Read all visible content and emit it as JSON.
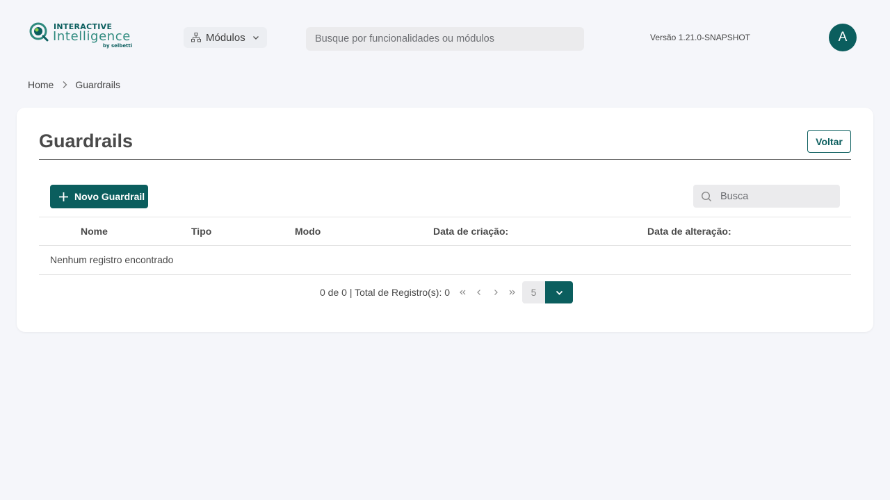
{
  "header": {
    "logo": {
      "line1": "INTERACTIVE",
      "line2": "Intelligence",
      "line3": "by selbetti"
    },
    "modules_label": "Módulos",
    "search_placeholder": "Busque por funcionalidades ou módulos",
    "version": "Versão 1.21.0-SNAPSHOT",
    "avatar_initial": "A"
  },
  "breadcrumb": {
    "home": "Home",
    "current": "Guardrails"
  },
  "page": {
    "title": "Guardrails",
    "back_label": "Voltar",
    "new_label": "Novo Guardrail",
    "search_placeholder": "Busca"
  },
  "table": {
    "columns": [
      "Nome",
      "Tipo",
      "Modo",
      "Data de criação:",
      "Data de alteração:"
    ],
    "empty_message": "Nenhum registro encontrado"
  },
  "pagination": {
    "info": "0 de 0 | Total de Registro(s): 0",
    "page_size": "5"
  },
  "colors": {
    "primary": "#0b5e5e",
    "background": "#f5f6fa"
  }
}
